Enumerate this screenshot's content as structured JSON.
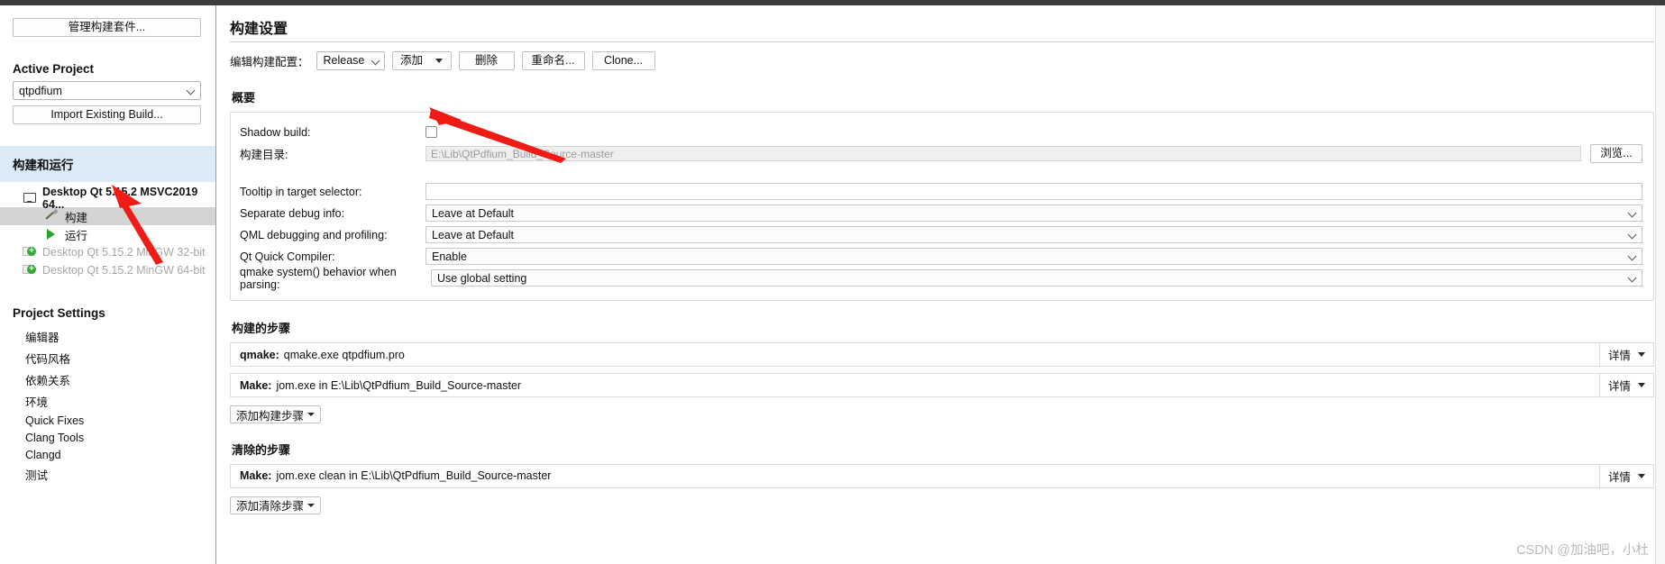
{
  "sidebar": {
    "manage_kits_button": "管理构建套件...",
    "active_project_heading": "Active Project",
    "active_project_value": "qtpdfium",
    "import_build_button": "Import Existing Build...",
    "build_and_run_heading": "构建和运行",
    "kits": [
      {
        "label": "Desktop Qt 5.15.2 MSVC2019 64...",
        "icon": "monitor-icon",
        "state": "active"
      },
      {
        "label": "构建",
        "icon": "hammer-icon",
        "state": "selected-child"
      },
      {
        "label": "运行",
        "icon": "play-icon",
        "state": "child"
      },
      {
        "label": "Desktop Qt 5.15.2 MinGW 32-bit",
        "icon": "monitor-add-icon",
        "state": "disabled"
      },
      {
        "label": "Desktop Qt 5.15.2 MinGW 64-bit",
        "icon": "monitor-add-icon",
        "state": "disabled"
      }
    ],
    "project_settings_heading": "Project Settings",
    "project_settings_items": [
      "编辑器",
      "代码风格",
      "依赖关系",
      "环境",
      "Quick Fixes",
      "Clang Tools",
      "Clangd",
      "测试"
    ]
  },
  "main": {
    "page_title": "构建设置",
    "config_bar": {
      "label": "编辑构建配置：",
      "selected_config": "Release",
      "add_button": "添加",
      "remove_button": "删除",
      "rename_button": "重命名...",
      "clone_button": "Clone..."
    },
    "summary": {
      "heading": "概要",
      "shadow_build_label": "Shadow build:",
      "shadow_build_checked": false,
      "build_dir_label": "构建目录:",
      "build_dir_value": "E:\\Lib\\QtPdfium_Build_Source-master",
      "browse_button": "浏览...",
      "tooltip_label": "Tooltip in target selector:",
      "tooltip_value": "",
      "separate_debug_label": "Separate debug info:",
      "separate_debug_value": "Leave at Default",
      "qml_debug_label": "QML debugging and profiling:",
      "qml_debug_value": "Leave at Default",
      "qt_quick_compiler_label": "Qt Quick Compiler:",
      "qt_quick_compiler_value": "Enable",
      "qmake_system_label": "qmake system() behavior when parsing:",
      "qmake_system_value": "Use global setting"
    },
    "build_steps": {
      "heading": "构建的步骤",
      "steps": [
        {
          "name": "qmake:",
          "command": "qmake.exe qtpdfium.pro",
          "details_button": "详情"
        },
        {
          "name": "Make:",
          "command": "jom.exe in E:\\Lib\\QtPdfium_Build_Source-master",
          "details_button": "详情"
        }
      ],
      "add_button": "添加构建步骤"
    },
    "clean_steps": {
      "heading": "清除的步骤",
      "steps": [
        {
          "name": "Make:",
          "command": "jom.exe clean in E:\\Lib\\QtPdfium_Build_Source-master",
          "details_button": "详情"
        }
      ],
      "add_button": "添加清除步骤"
    }
  },
  "watermark": "CSDN @加油吧，小杜",
  "colors": {
    "accent_banner": "#dbeaf7",
    "selection": "#d4d4d4",
    "annotation_arrow": "#ee1c15",
    "disabled_text": "#a6a6a6"
  }
}
